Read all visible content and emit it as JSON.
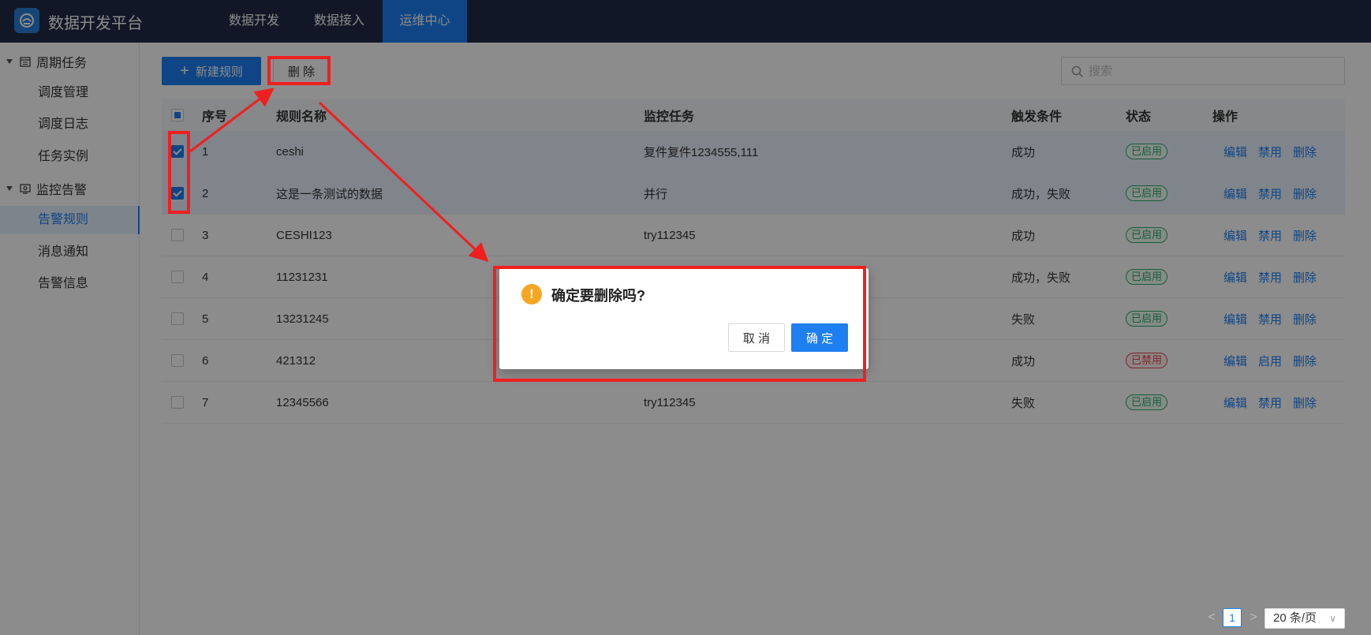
{
  "app": {
    "title": "数据开发平台"
  },
  "nav": [
    {
      "label": "数据开发",
      "active": false
    },
    {
      "label": "数据接入",
      "active": false
    },
    {
      "label": "运维中心",
      "active": true
    }
  ],
  "sidebar": {
    "groups": [
      {
        "label": "周期任务",
        "icon": "calendar-icon",
        "items": [
          "调度管理",
          "调度日志",
          "任务实例"
        ]
      },
      {
        "label": "监控告警",
        "icon": "monitor-icon",
        "items": [
          "告警规则",
          "消息通知",
          "告警信息"
        ]
      }
    ],
    "active_item": "告警规则"
  },
  "toolbar": {
    "new_label": "新建规则",
    "delete_label": "删 除",
    "search_placeholder": "搜索"
  },
  "table": {
    "headers": [
      "序号",
      "规则名称",
      "监控任务",
      "触发条件",
      "状态",
      "操作"
    ],
    "rows": [
      {
        "no": "1",
        "name": "ceshi",
        "task": "复件复件1234555,111",
        "cond": "成功",
        "status": "已启用",
        "enabled": true,
        "checked": true,
        "ops": [
          "编辑",
          "禁用",
          "删除"
        ]
      },
      {
        "no": "2",
        "name": "这是一条测试的数据",
        "task": "并行",
        "cond": "成功，失败",
        "status": "已启用",
        "enabled": true,
        "checked": true,
        "ops": [
          "编辑",
          "禁用",
          "删除"
        ]
      },
      {
        "no": "3",
        "name": "CESHI123",
        "task": "try112345",
        "cond": "成功",
        "status": "已启用",
        "enabled": true,
        "checked": false,
        "ops": [
          "编辑",
          "禁用",
          "删除"
        ]
      },
      {
        "no": "4",
        "name": "11231231",
        "task": "",
        "cond": "成功，失败",
        "status": "已启用",
        "enabled": true,
        "checked": false,
        "ops": [
          "编辑",
          "禁用",
          "删除"
        ]
      },
      {
        "no": "5",
        "name": "13231245",
        "task": "",
        "cond": "失败",
        "status": "已启用",
        "enabled": true,
        "checked": false,
        "ops": [
          "编辑",
          "禁用",
          "删除"
        ]
      },
      {
        "no": "6",
        "name": "421312",
        "task": "",
        "cond": "成功",
        "status": "已禁用",
        "enabled": false,
        "checked": false,
        "ops": [
          "编辑",
          "启用",
          "删除"
        ]
      },
      {
        "no": "7",
        "name": "12345566",
        "task": "try112345",
        "cond": "失败",
        "status": "已启用",
        "enabled": true,
        "checked": false,
        "ops": [
          "编辑",
          "禁用",
          "删除"
        ]
      }
    ]
  },
  "dialog": {
    "message": "确定要删除吗?",
    "cancel_label": "取 消",
    "ok_label": "确 定"
  },
  "pagination": {
    "current_page": "1",
    "page_size": "20 条/页",
    "prev": "<",
    "next": ">"
  },
  "colors": {
    "topbar": "#1f2b45",
    "accent": "#1d7ff0",
    "enabled": "#2fa86b",
    "disabled": "#e04a4a",
    "annotation": "#f01f1f"
  }
}
